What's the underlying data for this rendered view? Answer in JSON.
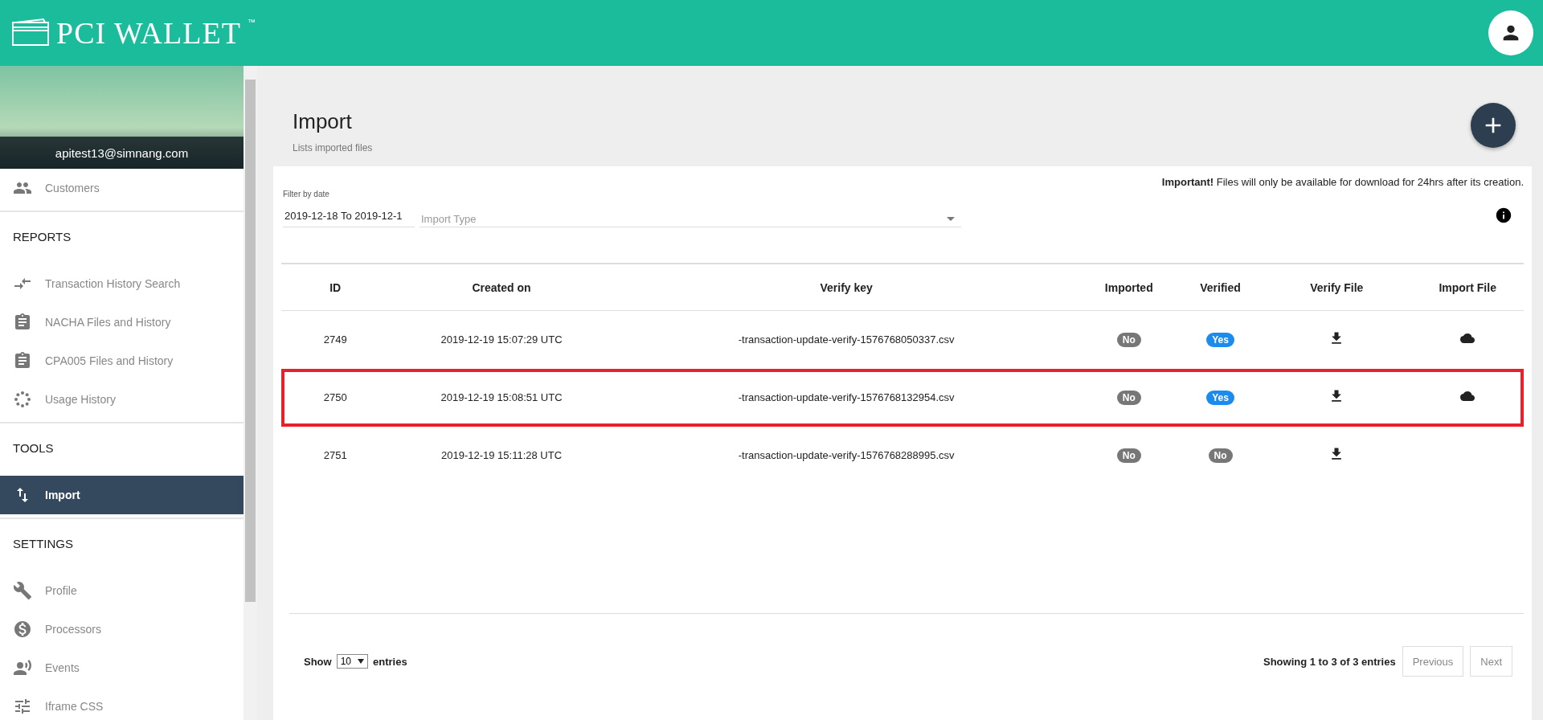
{
  "header": {
    "logo": "PCI WALLET",
    "trademark": "™"
  },
  "sidebar": {
    "email": "apitest13@simnang.com",
    "sections": [
      {
        "items": [
          {
            "label": "Customers",
            "selected": false
          }
        ]
      },
      {
        "heading": "REPORTS",
        "items": [
          {
            "label": "Transaction History Search",
            "selected": false
          },
          {
            "label": "NACHA Files and History",
            "selected": false
          },
          {
            "label": "CPA005 Files and History",
            "selected": false
          },
          {
            "label": "Usage History",
            "selected": false
          }
        ]
      },
      {
        "heading": "TOOLS",
        "items": [
          {
            "label": "Import",
            "selected": true
          }
        ]
      },
      {
        "heading": "SETTINGS",
        "items": [
          {
            "label": "Profile",
            "selected": false
          },
          {
            "label": "Processors",
            "selected": false
          },
          {
            "label": "Events",
            "selected": false
          },
          {
            "label": "Iframe CSS",
            "selected": false
          }
        ]
      }
    ]
  },
  "page": {
    "title": "Import",
    "subtitle": "Lists imported files"
  },
  "notice": {
    "strong": "Important!",
    "text": "Files will only be available for download for 24hrs after its creation."
  },
  "filter": {
    "label": "Filter by date",
    "value": "2019-12-18 To 2019-12-1",
    "type_placeholder": "Import Type"
  },
  "table": {
    "columns": [
      "ID",
      "Created on",
      "Verify key",
      "Imported",
      "Verified",
      "Verify File",
      "Import File"
    ],
    "rows": [
      {
        "id": "2749",
        "created": "2019-12-19 15:07:29 UTC",
        "key": "-transaction-update-verify-1576768050337.csv",
        "imported": {
          "text": "No",
          "on": false
        },
        "verified": {
          "text": "Yes",
          "on": true
        },
        "import_available": true,
        "highlighted": false
      },
      {
        "id": "2750",
        "created": "2019-12-19 15:08:51 UTC",
        "key": "-transaction-update-verify-1576768132954.csv",
        "imported": {
          "text": "No",
          "on": false
        },
        "verified": {
          "text": "Yes",
          "on": true
        },
        "import_available": true,
        "highlighted": true
      },
      {
        "id": "2751",
        "created": "2019-12-19 15:11:28 UTC",
        "key": "-transaction-update-verify-1576768288995.csv",
        "imported": {
          "text": "No",
          "on": false
        },
        "verified": {
          "text": "No",
          "on": false
        },
        "import_available": false,
        "highlighted": false
      }
    ]
  },
  "footer": {
    "show": "Show",
    "page_size": "10",
    "entries": "entries",
    "summary_pre": "Showing",
    "from": "1",
    "to_word": "to",
    "to": "3",
    "of_word": "of",
    "total": "3",
    "summary_post": "entries",
    "buttons": [
      {
        "label": "Previous",
        "disabled": true
      },
      {
        "label": "Next",
        "disabled": true
      }
    ]
  }
}
